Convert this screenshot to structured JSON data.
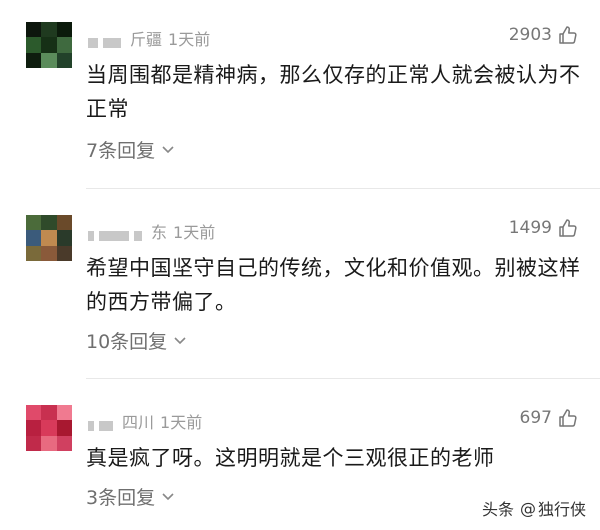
{
  "comments": [
    {
      "location": "疆",
      "location_prefix": "斤",
      "time": "1天前",
      "likes": "2903",
      "text": "当周围都是精神病，那么仅存的正常人就会被认为不正常",
      "replies": "7条回复",
      "avatar_colors": [
        "#0d160d",
        "#1f3a1f",
        "#0b1a0b",
        "#2c5a2c",
        "#163016",
        "#3f6a3f",
        "#0e1d0e",
        "#5b8c5b",
        "#22422a"
      ]
    },
    {
      "location": "东",
      "location_prefix": "",
      "time": "1天前",
      "likes": "1499",
      "text": "希望中国坚守自己的传统，文化和价值观。别被这样的西方带偏了。",
      "replies": "10条回复",
      "avatar_colors": [
        "#4b6b3a",
        "#2f4a2a",
        "#6a4a2a",
        "#3b5b7b",
        "#c08a50",
        "#2a3a2a",
        "#7a6a3a",
        "#8a5a3a",
        "#4a3a2a"
      ]
    },
    {
      "location": "四川",
      "location_prefix": "",
      "time": "1天前",
      "likes": "697",
      "text": "真是疯了呀。这明明就是个三观很正的老师",
      "replies": "3条回复",
      "avatar_colors": [
        "#e04a6a",
        "#c83050",
        "#f07a90",
        "#b82040",
        "#d83a5a",
        "#a81830",
        "#c02a4a",
        "#e86a80",
        "#d04060"
      ]
    }
  ],
  "watermark": {
    "source": "头条",
    "at": "@",
    "author": "独行侠"
  }
}
